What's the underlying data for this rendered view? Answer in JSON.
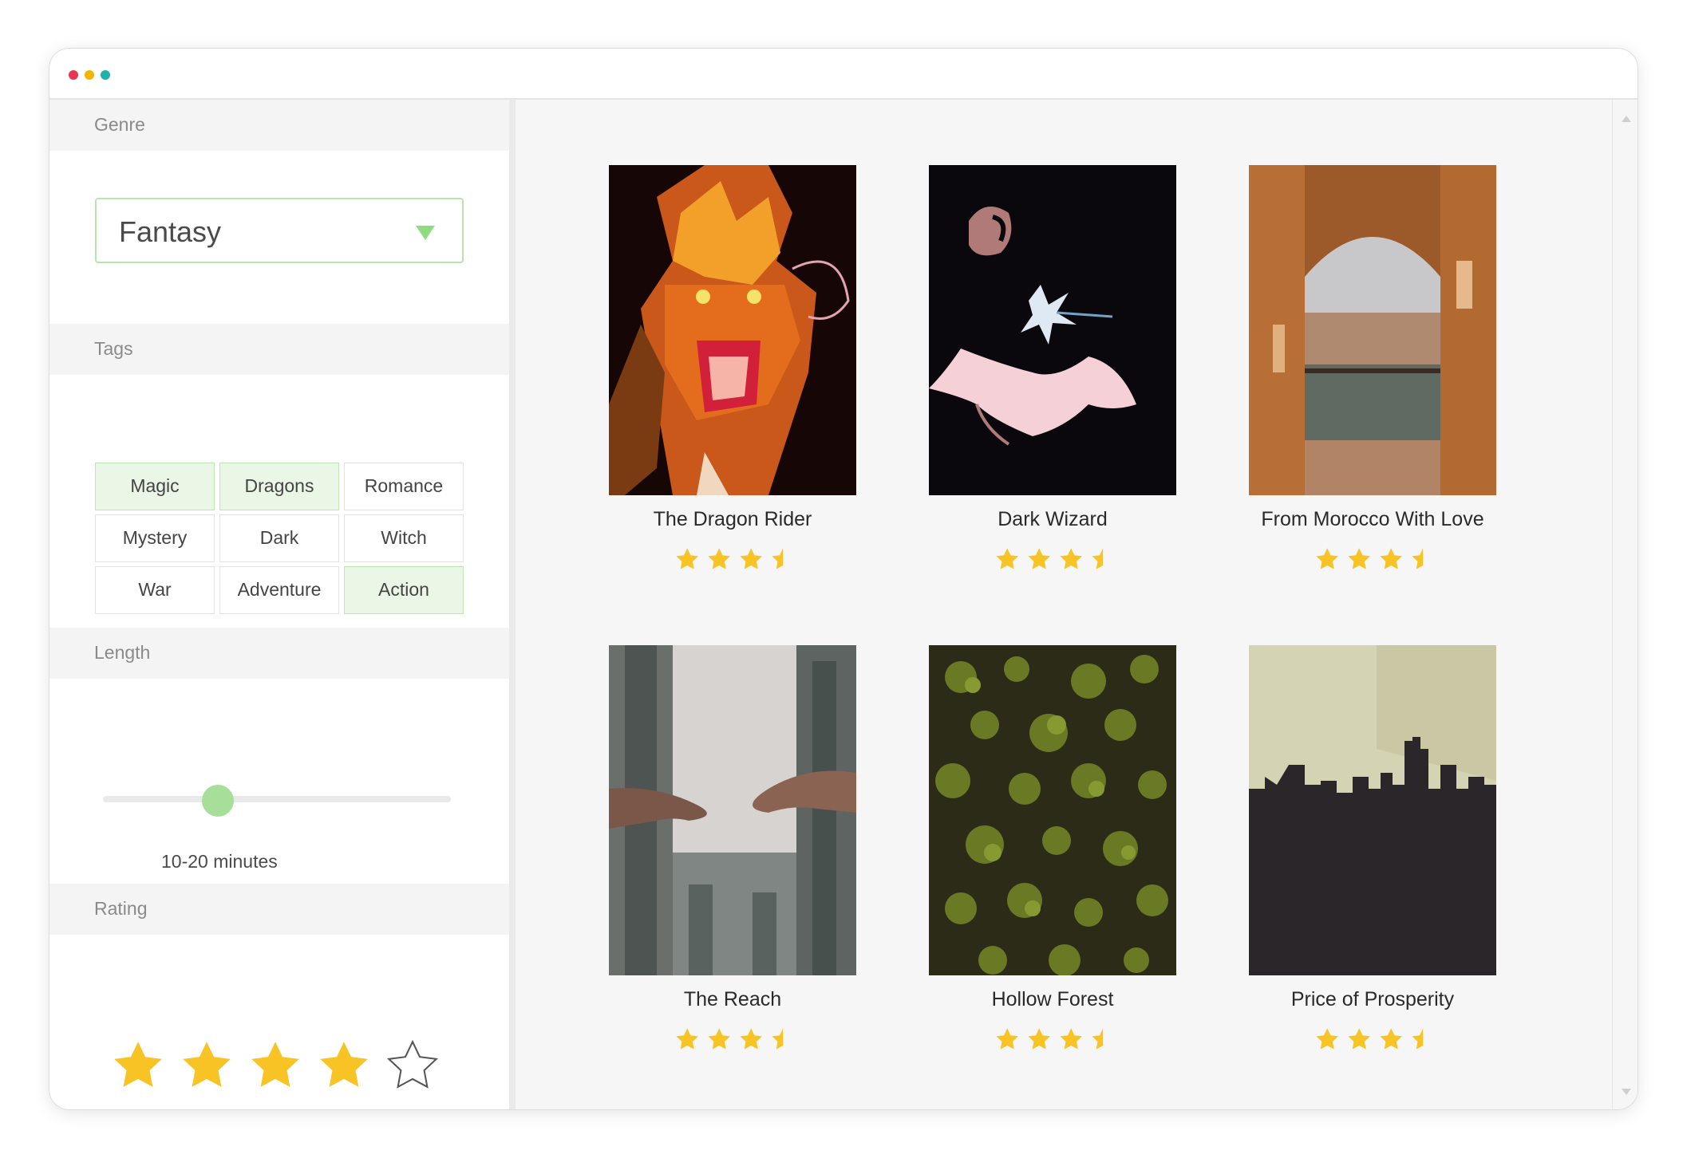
{
  "window": {
    "controls": [
      "close",
      "minimize",
      "maximize"
    ],
    "colors": {
      "close": "#e8364f",
      "minimize": "#f4b400",
      "maximize": "#1fb2a8"
    }
  },
  "sidebar": {
    "genre": {
      "header": "Genre",
      "selected": "Fantasy",
      "icon": "triangle-down-icon"
    },
    "tags": {
      "header": "Tags",
      "items": [
        {
          "label": "Magic",
          "selected": true
        },
        {
          "label": "Dragons",
          "selected": true
        },
        {
          "label": "Romance",
          "selected": false
        },
        {
          "label": "Mystery",
          "selected": false
        },
        {
          "label": "Dark",
          "selected": false
        },
        {
          "label": "Witch",
          "selected": false
        },
        {
          "label": "War",
          "selected": false
        },
        {
          "label": "Adventure",
          "selected": false
        },
        {
          "label": "Action",
          "selected": true
        }
      ]
    },
    "length": {
      "header": "Length",
      "value_label": "10-20 minutes",
      "slider_fraction": 0.33
    },
    "rating": {
      "header": "Rating",
      "value": 4,
      "max": 5
    }
  },
  "books": [
    {
      "title": "The Dragon Rider",
      "rating": 3.5,
      "cover": "dragon"
    },
    {
      "title": "Dark Wizard",
      "rating": 3.5,
      "cover": "wizard"
    },
    {
      "title": "From Morocco With Love",
      "rating": 3.5,
      "cover": "arch"
    },
    {
      "title": "The Reach",
      "rating": 3.5,
      "cover": "hands"
    },
    {
      "title": "Hollow Forest",
      "rating": 3.5,
      "cover": "forest"
    },
    {
      "title": "Price of Prosperity",
      "rating": 3.5,
      "cover": "skyline"
    }
  ],
  "colors": {
    "accent": "#a7df9a",
    "star": "#f7c325",
    "tag_selected_bg": "#eaf7e6"
  }
}
